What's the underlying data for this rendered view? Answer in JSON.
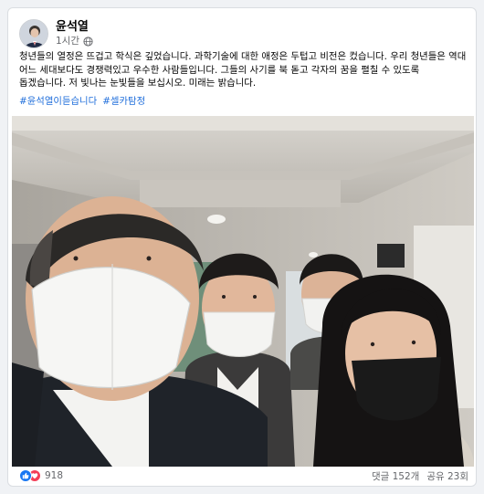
{
  "post": {
    "author": "윤석열",
    "time": "1시간",
    "icons": {
      "avatar": "profile-photo",
      "privacy": "globe-icon"
    },
    "text": "청년들의 열정은 뜨겁고 학식은 깊었습니다. 과학기술에 대한 애정은 두텁고 비전은 컸습니다. 우리 청년들은 역대 어느 세대보다도 경쟁력있고 우수한 사람들입니다. 그들의 사기를 북 돋고 각자의 꿈을 펼칠 수 있도록 돕겠습니다. 저 빛나는 눈빛들을 보십시오. 미래는 밝습니다.",
    "hashtags": [
      "#윤석열이듣습니다",
      "#셀카탐정"
    ],
    "photo_description_name": "group-selfie-photo"
  },
  "footer": {
    "reaction_icons": [
      "like-icon",
      "love-icon"
    ],
    "reaction_count": "918",
    "comments": "댓글 152개",
    "shares": "공유 23회"
  },
  "colors": {
    "link": "#216fdb",
    "like": "#1877f2",
    "love": "#f33e58",
    "secondary_text": "#65676b"
  }
}
